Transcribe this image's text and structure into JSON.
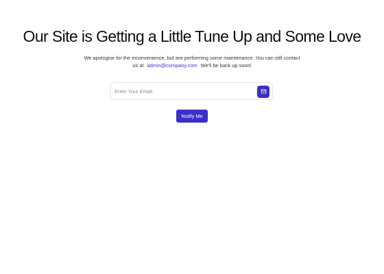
{
  "page": {
    "heading": "Our Site is Getting a Little Tune Up and Some Love",
    "description_before": "We apologise for the inconvenience, but are performing some maintenance. You can still contact us at",
    "contact_email": "admin@company.com",
    "description_after": "We'll be back up soon!"
  },
  "form": {
    "email_placeholder": "Enter Your Email",
    "email_value": "",
    "submit_icon": "mail-icon",
    "notify_label": "Notify Me"
  },
  "colors": {
    "accent": "#3a2fc8",
    "link": "#3a2fd0",
    "heading": "#0e0e12",
    "background": "#ffffff"
  }
}
